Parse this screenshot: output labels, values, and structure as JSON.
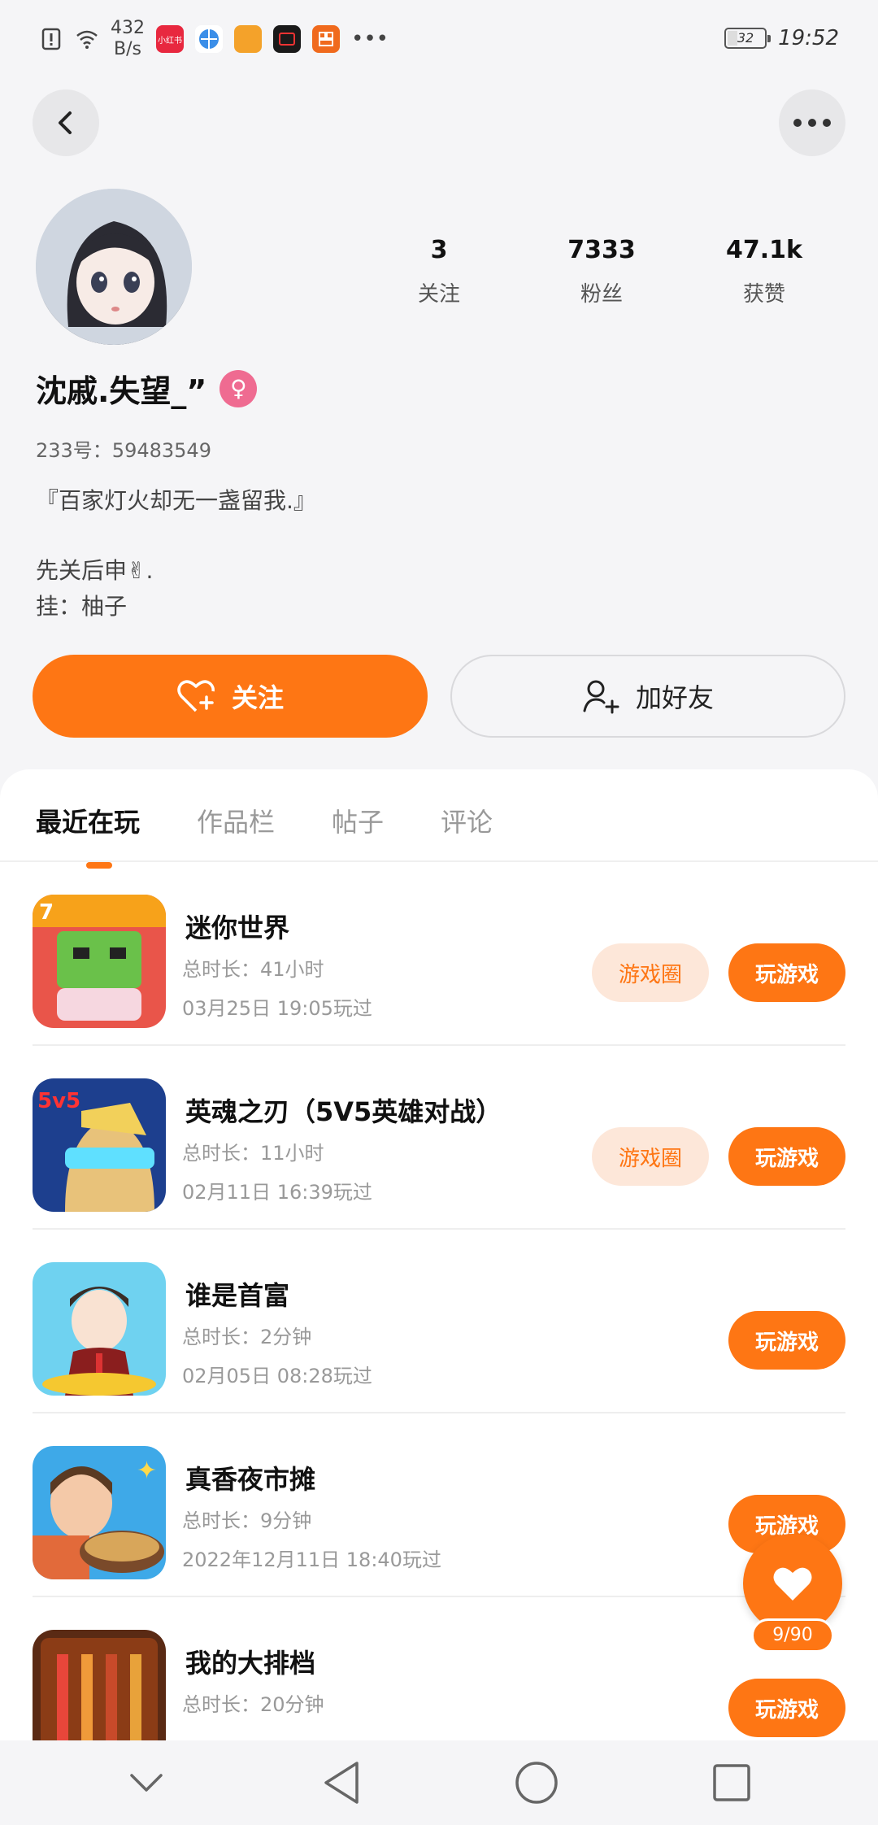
{
  "status_bar": {
    "net_speed_value": "432",
    "net_speed_unit": "B/s",
    "apps": [
      {
        "name": "xiaohongshu",
        "label": "小红书",
        "color": "#e8283f"
      },
      {
        "name": "browser",
        "label": "",
        "color": "#3b8ee8"
      },
      {
        "name": "app-orange",
        "label": "",
        "color": "#f4a22a"
      },
      {
        "name": "app-black",
        "label": "",
        "color": "#1a1a1a"
      },
      {
        "name": "app-red",
        "label": "",
        "color": "#f06a1d"
      }
    ],
    "battery": "32",
    "time": "19:52"
  },
  "profile": {
    "stats": [
      {
        "value": "3",
        "label": "关注"
      },
      {
        "value": "7333",
        "label": "粉丝"
      },
      {
        "value": "47.1k",
        "label": "获赞"
      }
    ],
    "username": "沈戚.失望_”",
    "gender_symbol": "♀",
    "account_id": "233号：59483549",
    "bio_line1": "『百家灯火却无一盏留我.』",
    "bio_line2": "先关后申✌.",
    "bio_line3": "挂：柚子"
  },
  "actions": {
    "follow_label": "关注",
    "add_friend_label": "加好友"
  },
  "tabs": [
    "最近在玩",
    "作品栏",
    "帖子",
    "评论"
  ],
  "games": [
    {
      "name": "迷你世界",
      "duration": "总时长：41小时",
      "last_played": "03月25日  19:05玩过",
      "circle": "游戏圈",
      "play": "玩游戏"
    },
    {
      "name": "英魂之刃（5V5英雄对战）",
      "duration": "总时长：11小时",
      "last_played": "02月11日  16:39玩过",
      "circle": "游戏圈",
      "play": "玩游戏"
    },
    {
      "name": "谁是首富",
      "duration": "总时长：2分钟",
      "last_played": "02月05日  08:28玩过",
      "circle": "",
      "play": "玩游戏"
    },
    {
      "name": "真香夜市摊",
      "duration": "总时长：9分钟",
      "last_played": "2022年12月11日  18:40玩过",
      "circle": "",
      "play": "玩游戏"
    },
    {
      "name": "我的大排档",
      "duration": "总时长：20分钟",
      "last_played": "",
      "circle": "",
      "play": "玩游戏"
    }
  ],
  "fab": {
    "count": "9/90"
  },
  "colors": {
    "accent": "#fe7614",
    "accent_light": "#fde7d9",
    "gender_pink": "#ef6b91"
  }
}
